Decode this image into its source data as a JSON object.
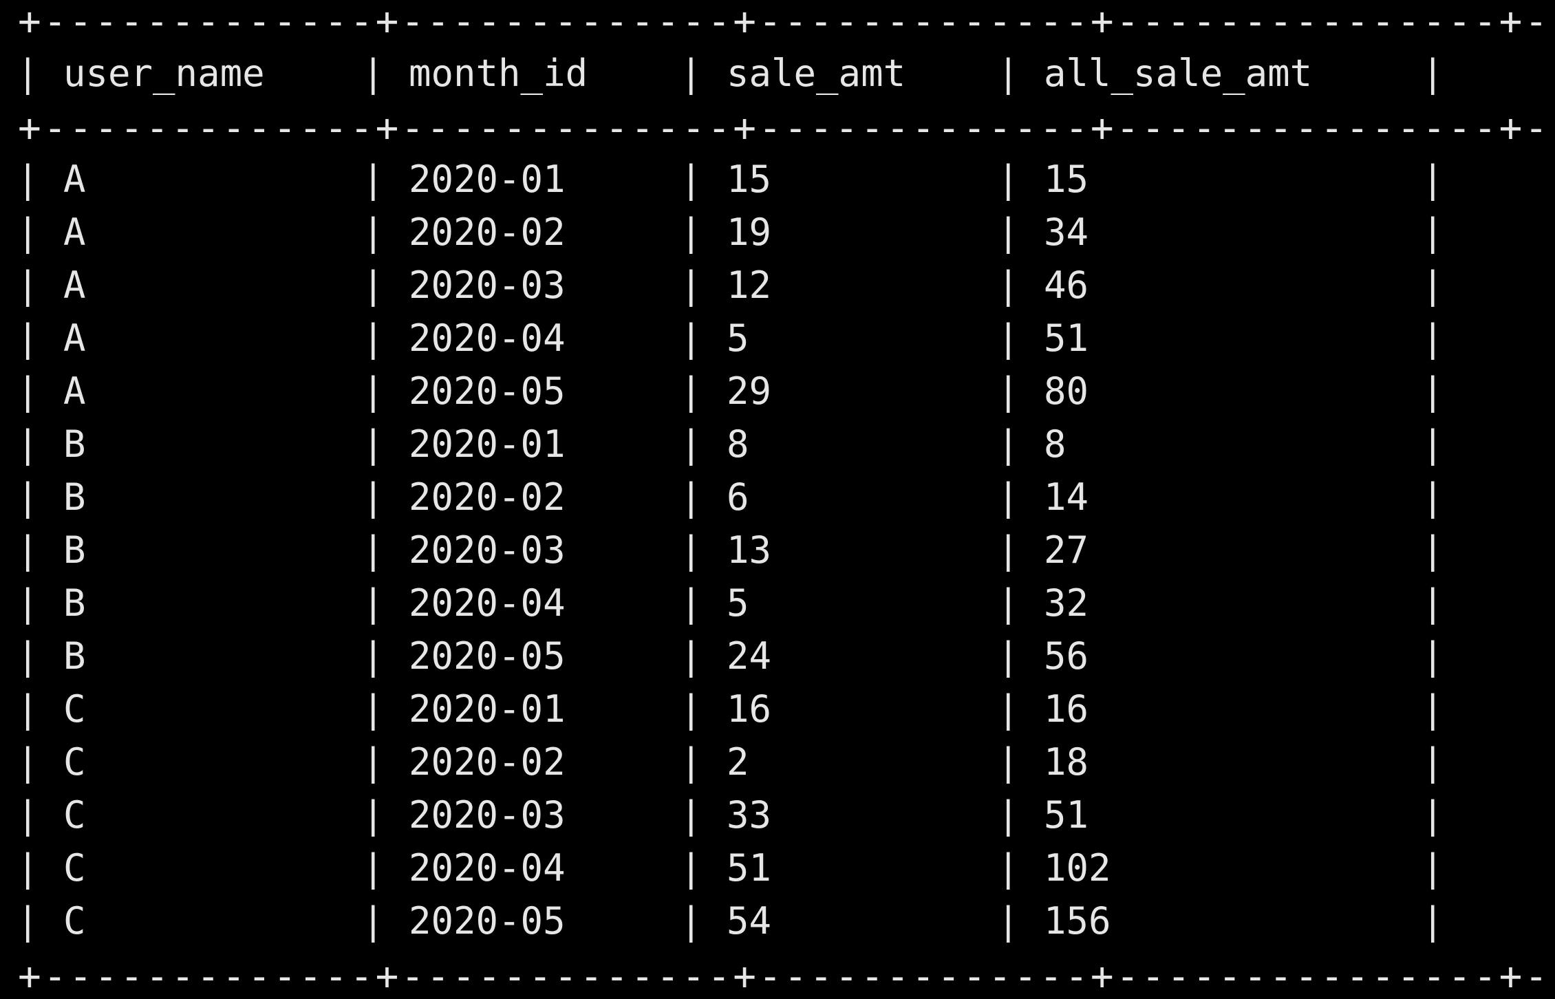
{
  "table": {
    "border_line": "+-------------+-------------+-------------+---------------+--+",
    "columns": [
      "user_name",
      "month_id",
      "sale_amt",
      "all_sale_amt"
    ],
    "rows": [
      [
        "A",
        "2020-01",
        "15",
        "15"
      ],
      [
        "A",
        "2020-02",
        "19",
        "34"
      ],
      [
        "A",
        "2020-03",
        "12",
        "46"
      ],
      [
        "A",
        "2020-04",
        "5",
        "51"
      ],
      [
        "A",
        "2020-05",
        "29",
        "80"
      ],
      [
        "B",
        "2020-01",
        "8",
        "8"
      ],
      [
        "B",
        "2020-02",
        "6",
        "14"
      ],
      [
        "B",
        "2020-03",
        "13",
        "27"
      ],
      [
        "B",
        "2020-04",
        "5",
        "32"
      ],
      [
        "B",
        "2020-05",
        "24",
        "56"
      ],
      [
        "C",
        "2020-01",
        "16",
        "16"
      ],
      [
        "C",
        "2020-02",
        "2",
        "18"
      ],
      [
        "C",
        "2020-03",
        "33",
        "51"
      ],
      [
        "C",
        "2020-04",
        "51",
        "102"
      ],
      [
        "C",
        "2020-05",
        "54",
        "156"
      ]
    ]
  }
}
